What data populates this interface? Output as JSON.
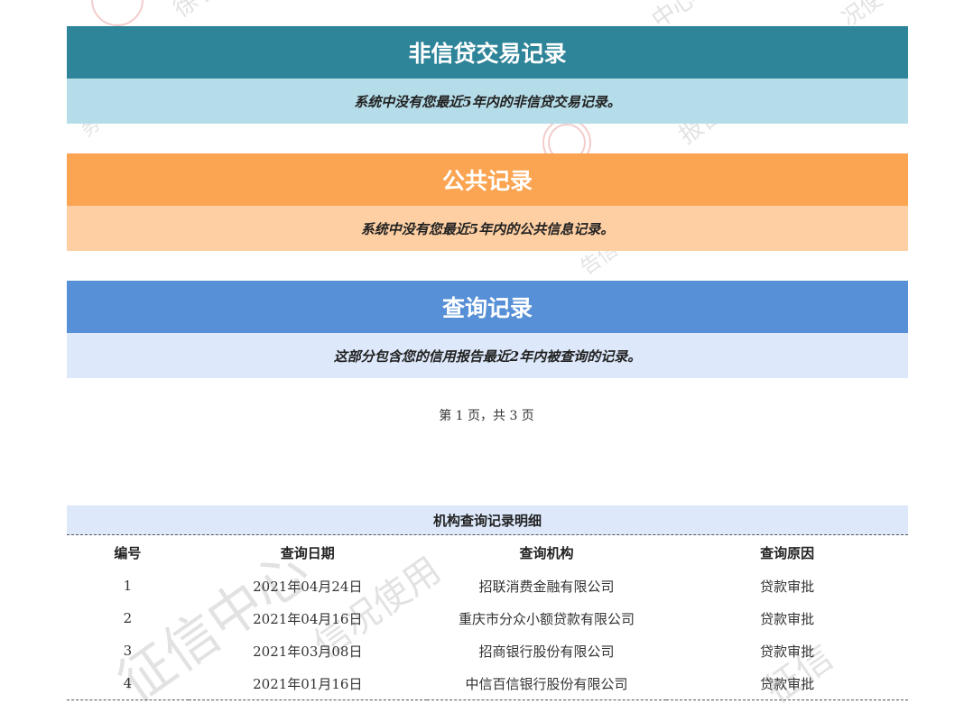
{
  "sections": [
    {
      "title": "非信贷交易记录",
      "body": "系统中没有您最近5年内的非信贷交易记录。"
    },
    {
      "title": "公共记录",
      "body": "系统中没有您最近5年内的公共信息记录。"
    },
    {
      "title": "查询记录",
      "body": "这部分包含您的信用报告最近2年内被查询的记录。"
    }
  ],
  "page_indicator": "第 1 页，共 3 页",
  "query_detail": {
    "title": "机构查询记录明细",
    "headers": [
      "编号",
      "查询日期",
      "查询机构",
      "查询原因"
    ],
    "rows": [
      [
        "1",
        "2021年04月24日",
        "招联消费金融有限公司",
        "贷款审批"
      ],
      [
        "2",
        "2021年04月16日",
        "重庆市分众小额贷款有限公司",
        "贷款审批"
      ],
      [
        "3",
        "2021年03月08日",
        "招商银行股份有限公司",
        "贷款审批"
      ],
      [
        "4",
        "2021年01月16日",
        "中信百信银行股份有限公司",
        "贷款审批"
      ]
    ]
  }
}
